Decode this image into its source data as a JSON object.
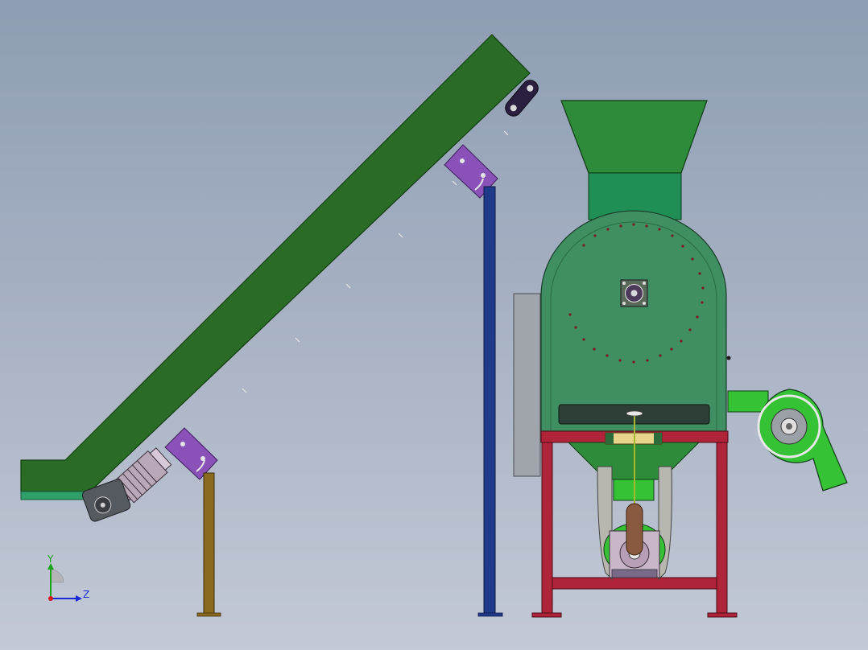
{
  "triad": {
    "y_label": "Y",
    "z_label": "Z",
    "y_color": "#1aa31a",
    "z_color": "#1a2ad6",
    "x_color": "#d61a1a"
  },
  "colors": {
    "conveyor_body": "#2a6b25",
    "conveyor_foot": "#2fa06a",
    "bracket": "#8a52b8",
    "leg_brown": "#8a6a1e",
    "leg_blue": "#1f3a8a",
    "hopper": "#2e8b3a",
    "hopper_neck": "#1f8f55",
    "drum": "#3f8f62",
    "frame": "#b0243a",
    "blower": "#35c235",
    "motor": "#b9a8b8",
    "gearbox": "#555a60"
  }
}
